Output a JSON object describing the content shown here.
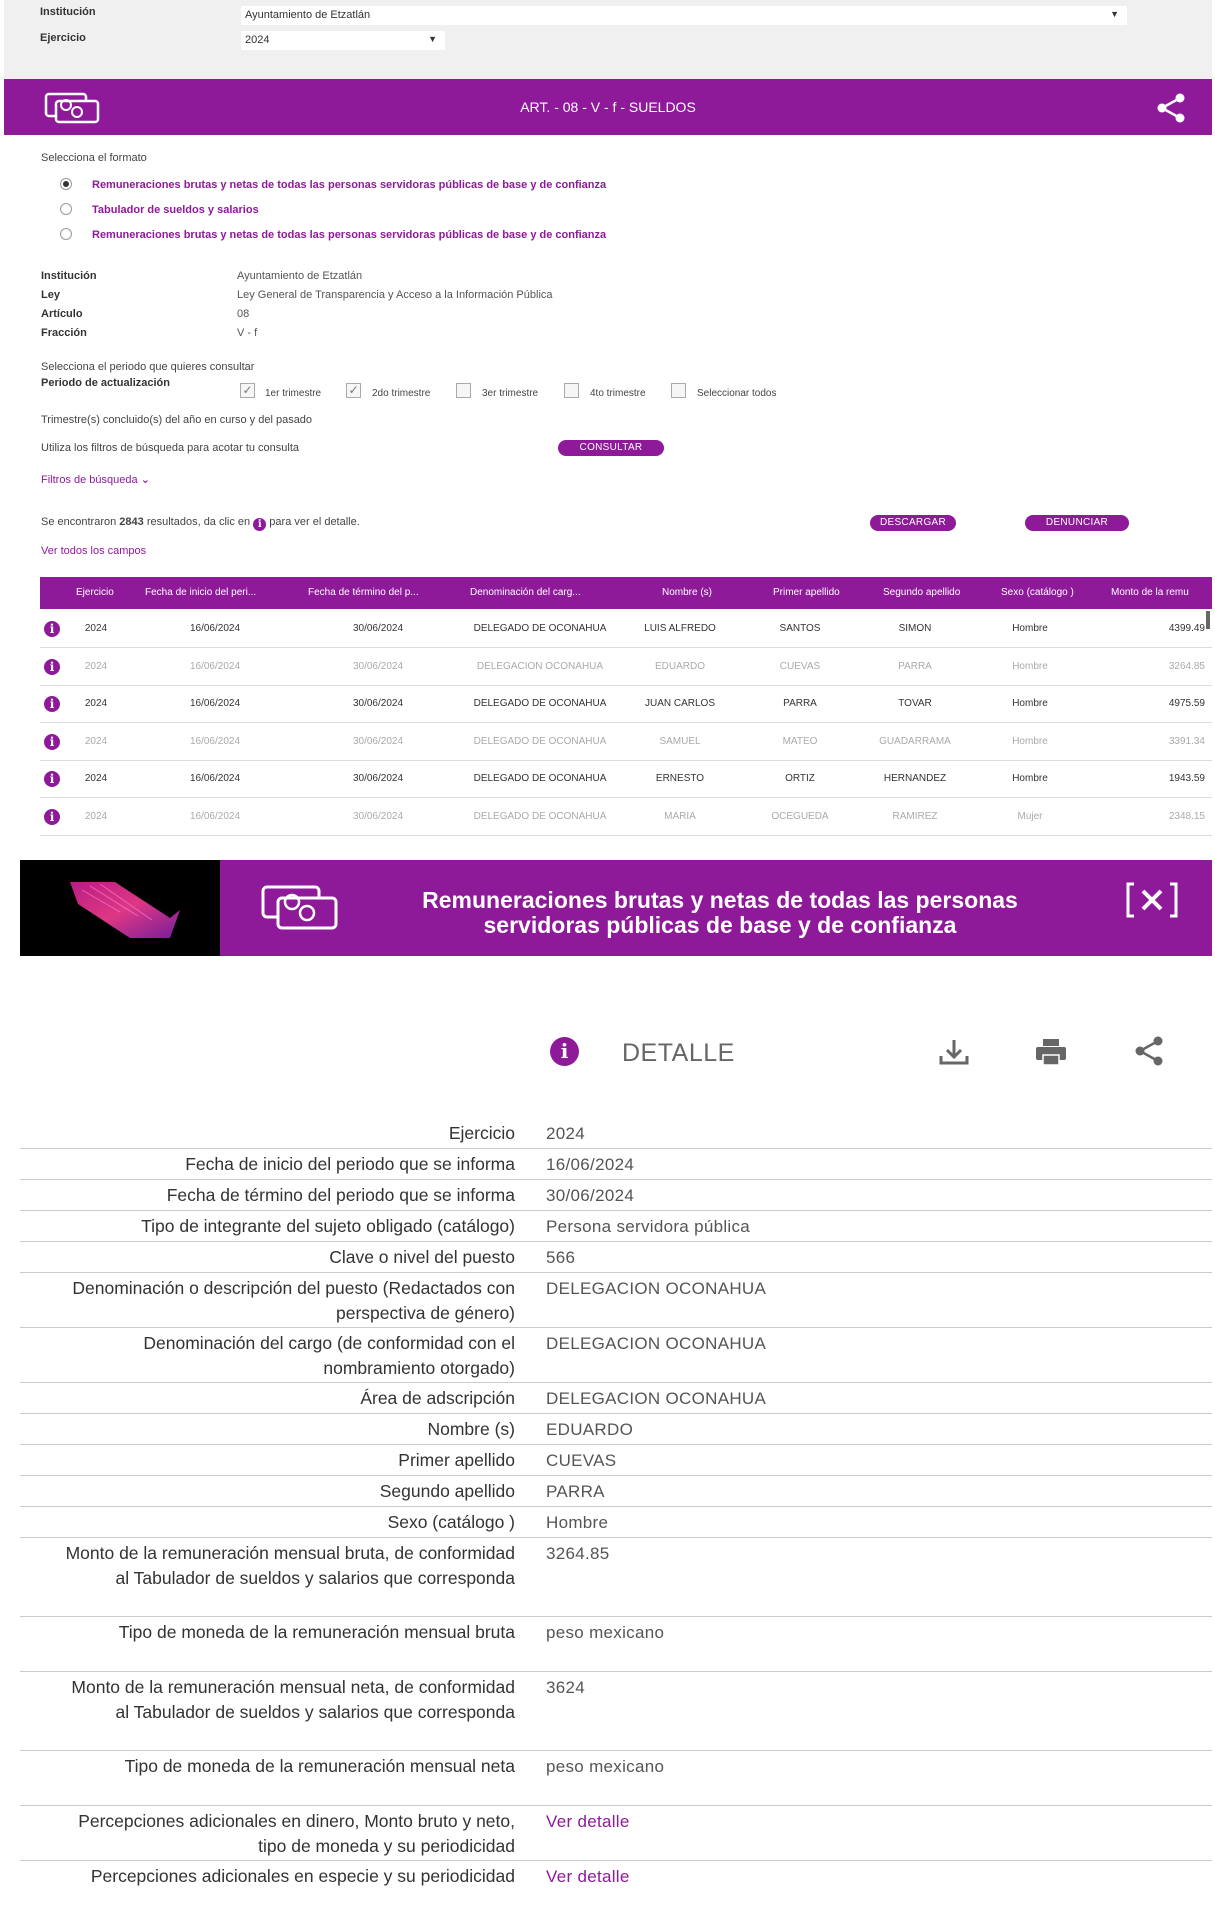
{
  "top": {
    "institucion_label": "Institución",
    "institucion_value": "Ayuntamiento de Etzatlán",
    "ejercicio_label": "Ejercicio",
    "ejercicio_value": "2024"
  },
  "article": {
    "title": "ART. - 08 - V - f - SUELDOS"
  },
  "format": {
    "prompt": "Selecciona el formato",
    "options": [
      "Remuneraciones brutas y netas de todas las personas servidoras públicas de base y de confianza",
      "Tabulador de sueldos y salarios",
      "Remuneraciones brutas y netas de todas las personas servidoras públicas de base y de confianza"
    ]
  },
  "meta": {
    "institucion_k": "Institución",
    "institucion_v": "Ayuntamiento de Etzatlán",
    "ley_k": "Ley",
    "ley_v": "Ley General de Transparencia y Acceso a la Información Pública",
    "articulo_k": "Artículo",
    "articulo_v": "08",
    "fraccion_k": "Fracción",
    "fraccion_v": "V - f"
  },
  "period": {
    "prompt": "Selecciona el periodo que quieres consultar",
    "label": "Periodo de actualización",
    "options": [
      "1er trimestre",
      "2do trimestre",
      "3er trimestre",
      "4to trimestre",
      "Seleccionar todos"
    ],
    "checked_mark": "✓",
    "note": "Trimestre(s) concluido(s) del año en curso y del pasado"
  },
  "filters": {
    "hint": "Utiliza los filtros de búsqueda para acotar tu consulta",
    "consultar": "CONSULTAR",
    "toggle": "Filtros de búsqueda",
    "toggle_chevron": "⌄"
  },
  "results": {
    "prefix": "Se encontraron",
    "count": "2843",
    "suffix": "resultados, da clic en",
    "suffix2": "para ver el detalle.",
    "descargar": "DESCARGAR",
    "denunciar": "DENUNCIAR",
    "ver_todos": "Ver todos los campos"
  },
  "table": {
    "headers": [
      "Ejercicio",
      "Fecha de inicio del peri...",
      "Fecha de término del p...",
      "Denominación del carg...",
      "Nombre (s)",
      "Primer apellido",
      "Segundo apellido",
      "Sexo (catálogo )",
      "Monto de la remu"
    ],
    "info_glyph": "i",
    "rows": [
      [
        "2024",
        "16/06/2024",
        "30/06/2024",
        "DELEGADO DE OCONAHUA",
        "LUIS ALFREDO",
        "SANTOS",
        "SIMON",
        "Hombre",
        "4399.49"
      ],
      [
        "2024",
        "16/06/2024",
        "30/06/2024",
        "DELEGACION OCONAHUA",
        "EDUARDO",
        "CUEVAS",
        "PARRA",
        "Hombre",
        "3264.85"
      ],
      [
        "2024",
        "16/06/2024",
        "30/06/2024",
        "DELEGADO DE OCONAHUA",
        "JUAN CARLOS",
        "PARRA",
        "TOVAR",
        "Hombre",
        "4975.59"
      ],
      [
        "2024",
        "16/06/2024",
        "30/06/2024",
        "DELEGADO DE OCONAHUA",
        "SAMUEL",
        "MATEO",
        "GUADARRAMA",
        "Hombre",
        "3391.34"
      ],
      [
        "2024",
        "16/06/2024",
        "30/06/2024",
        "DELEGADO DE OCONAHUA",
        "ERNESTO",
        "ORTIZ",
        "HERNANDEZ",
        "Hombre",
        "1943.59"
      ],
      [
        "2024",
        "16/06/2024",
        "30/06/2024",
        "DELEGADO DE OCONAHUA",
        "MARIA",
        "OCEGUEDA",
        "RAMIREZ",
        "Mujer",
        "2348.15"
      ]
    ]
  },
  "banner": {
    "title": "Remuneraciones brutas y netas de todas las personas servidoras públicas de base y de confianza"
  },
  "detail": {
    "title": "DETALLE",
    "rows": [
      {
        "k": "Ejercicio",
        "v": "2024"
      },
      {
        "k": "Fecha de inicio del periodo que se informa",
        "v": "16/06/2024"
      },
      {
        "k": "Fecha de término del periodo que se informa",
        "v": "30/06/2024"
      },
      {
        "k": "Tipo de integrante del sujeto obligado (catálogo)",
        "v": "Persona servidora pública"
      },
      {
        "k": "Clave o nivel del puesto",
        "v": "566"
      },
      {
        "k": "Denominación o descripción del puesto (Redactados con perspectiva de género)",
        "v": "DELEGACION OCONAHUA"
      },
      {
        "k": "Denominación del cargo (de conformidad con el nombramiento otorgado)",
        "v": "DELEGACION OCONAHUA"
      },
      {
        "k": "Área de adscripción",
        "v": "DELEGACION OCONAHUA"
      },
      {
        "k": "Nombre (s)",
        "v": "EDUARDO"
      },
      {
        "k": "Primer apellido",
        "v": "CUEVAS"
      },
      {
        "k": "Segundo apellido",
        "v": "PARRA"
      },
      {
        "k": "Sexo (catálogo )",
        "v": "Hombre"
      },
      {
        "k": "Monto de la remuneración mensual bruta, de conformidad al Tabulador de sueldos y salarios que corresponda",
        "v": "3264.85"
      },
      {
        "k": "Tipo de moneda de la remuneración mensual bruta",
        "v": "peso mexicano"
      },
      {
        "k": "Monto de la remuneración mensual neta, de conformidad al Tabulador de sueldos y salarios que corresponda",
        "v": "3624"
      },
      {
        "k": "Tipo de moneda de la remuneración mensual neta",
        "v": "peso mexicano"
      },
      {
        "k": "Percepciones adicionales en dinero, Monto bruto y neto, tipo de moneda y su periodicidad",
        "v": "Ver detalle"
      },
      {
        "k": "Percepciones adicionales en especie y su periodicidad",
        "v": "Ver detalle"
      }
    ]
  },
  "colors": {
    "accent": "#8e1a9a",
    "header_bg": "#f0f0f0"
  }
}
